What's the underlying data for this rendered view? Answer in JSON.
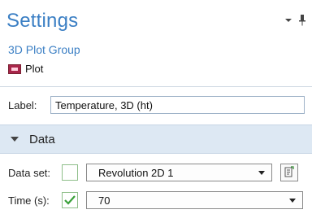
{
  "header": {
    "title": "Settings",
    "subtitle": "3D Plot Group",
    "node_label": "Plot",
    "icons": [
      "dropdown-arrow-icon",
      "pin-icon"
    ]
  },
  "label_field": {
    "label": "Label:",
    "value": "Temperature, 3D (ht)"
  },
  "section": {
    "title": "Data",
    "icon": "collapse-triangle-icon"
  },
  "dataset": {
    "label": "Data set:",
    "checked": false,
    "selected": "Revolution 2D 1",
    "action_icon": "dataset-goto-icon"
  },
  "time": {
    "label": "Time (s):",
    "checked": true,
    "selected": "70"
  },
  "colors": {
    "accent": "#3b7fc4",
    "section_bg": "#dde8f3",
    "check": "#3aa13a"
  }
}
